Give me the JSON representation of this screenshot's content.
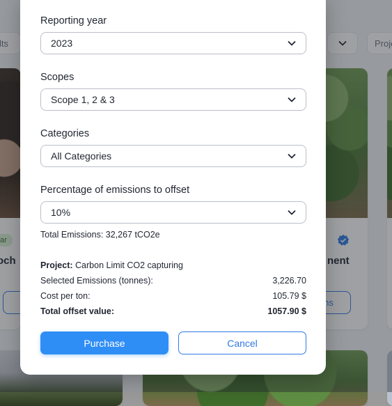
{
  "background": {
    "filter_left_text": "lts",
    "filter_right_text": "Proje",
    "pill_text": "ar",
    "card_left_title_fragment": "och",
    "card_right_title_fragment": "nent",
    "button_right_fragment": "ns"
  },
  "modal": {
    "reporting_year": {
      "label": "Reporting year",
      "value": "2023"
    },
    "scopes": {
      "label": "Scopes",
      "value": "Scope 1, 2 & 3"
    },
    "categories": {
      "label": "Categories",
      "value": "All Categories"
    },
    "offset_pct": {
      "label": "Percentage of emissions to offset",
      "value": "10%"
    },
    "total_emissions": "Total Emissions: 32,267 tCO2e",
    "project": {
      "label": "Project:",
      "value": "Carbon Limit CO2 capturing"
    },
    "selected_emissions": {
      "label": "Selected Emissions (tonnes):",
      "value": "3,226.70"
    },
    "cost_per_ton": {
      "label": "Cost per ton:",
      "value": "105.79 $"
    },
    "total_offset": {
      "label": "Total offset value:",
      "value": "1057.90 $"
    },
    "purchase_label": "Purchase",
    "cancel_label": "Cancel"
  },
  "colors": {
    "accent": "#2f8ef5",
    "accent_outline": "#2f7ae5"
  }
}
